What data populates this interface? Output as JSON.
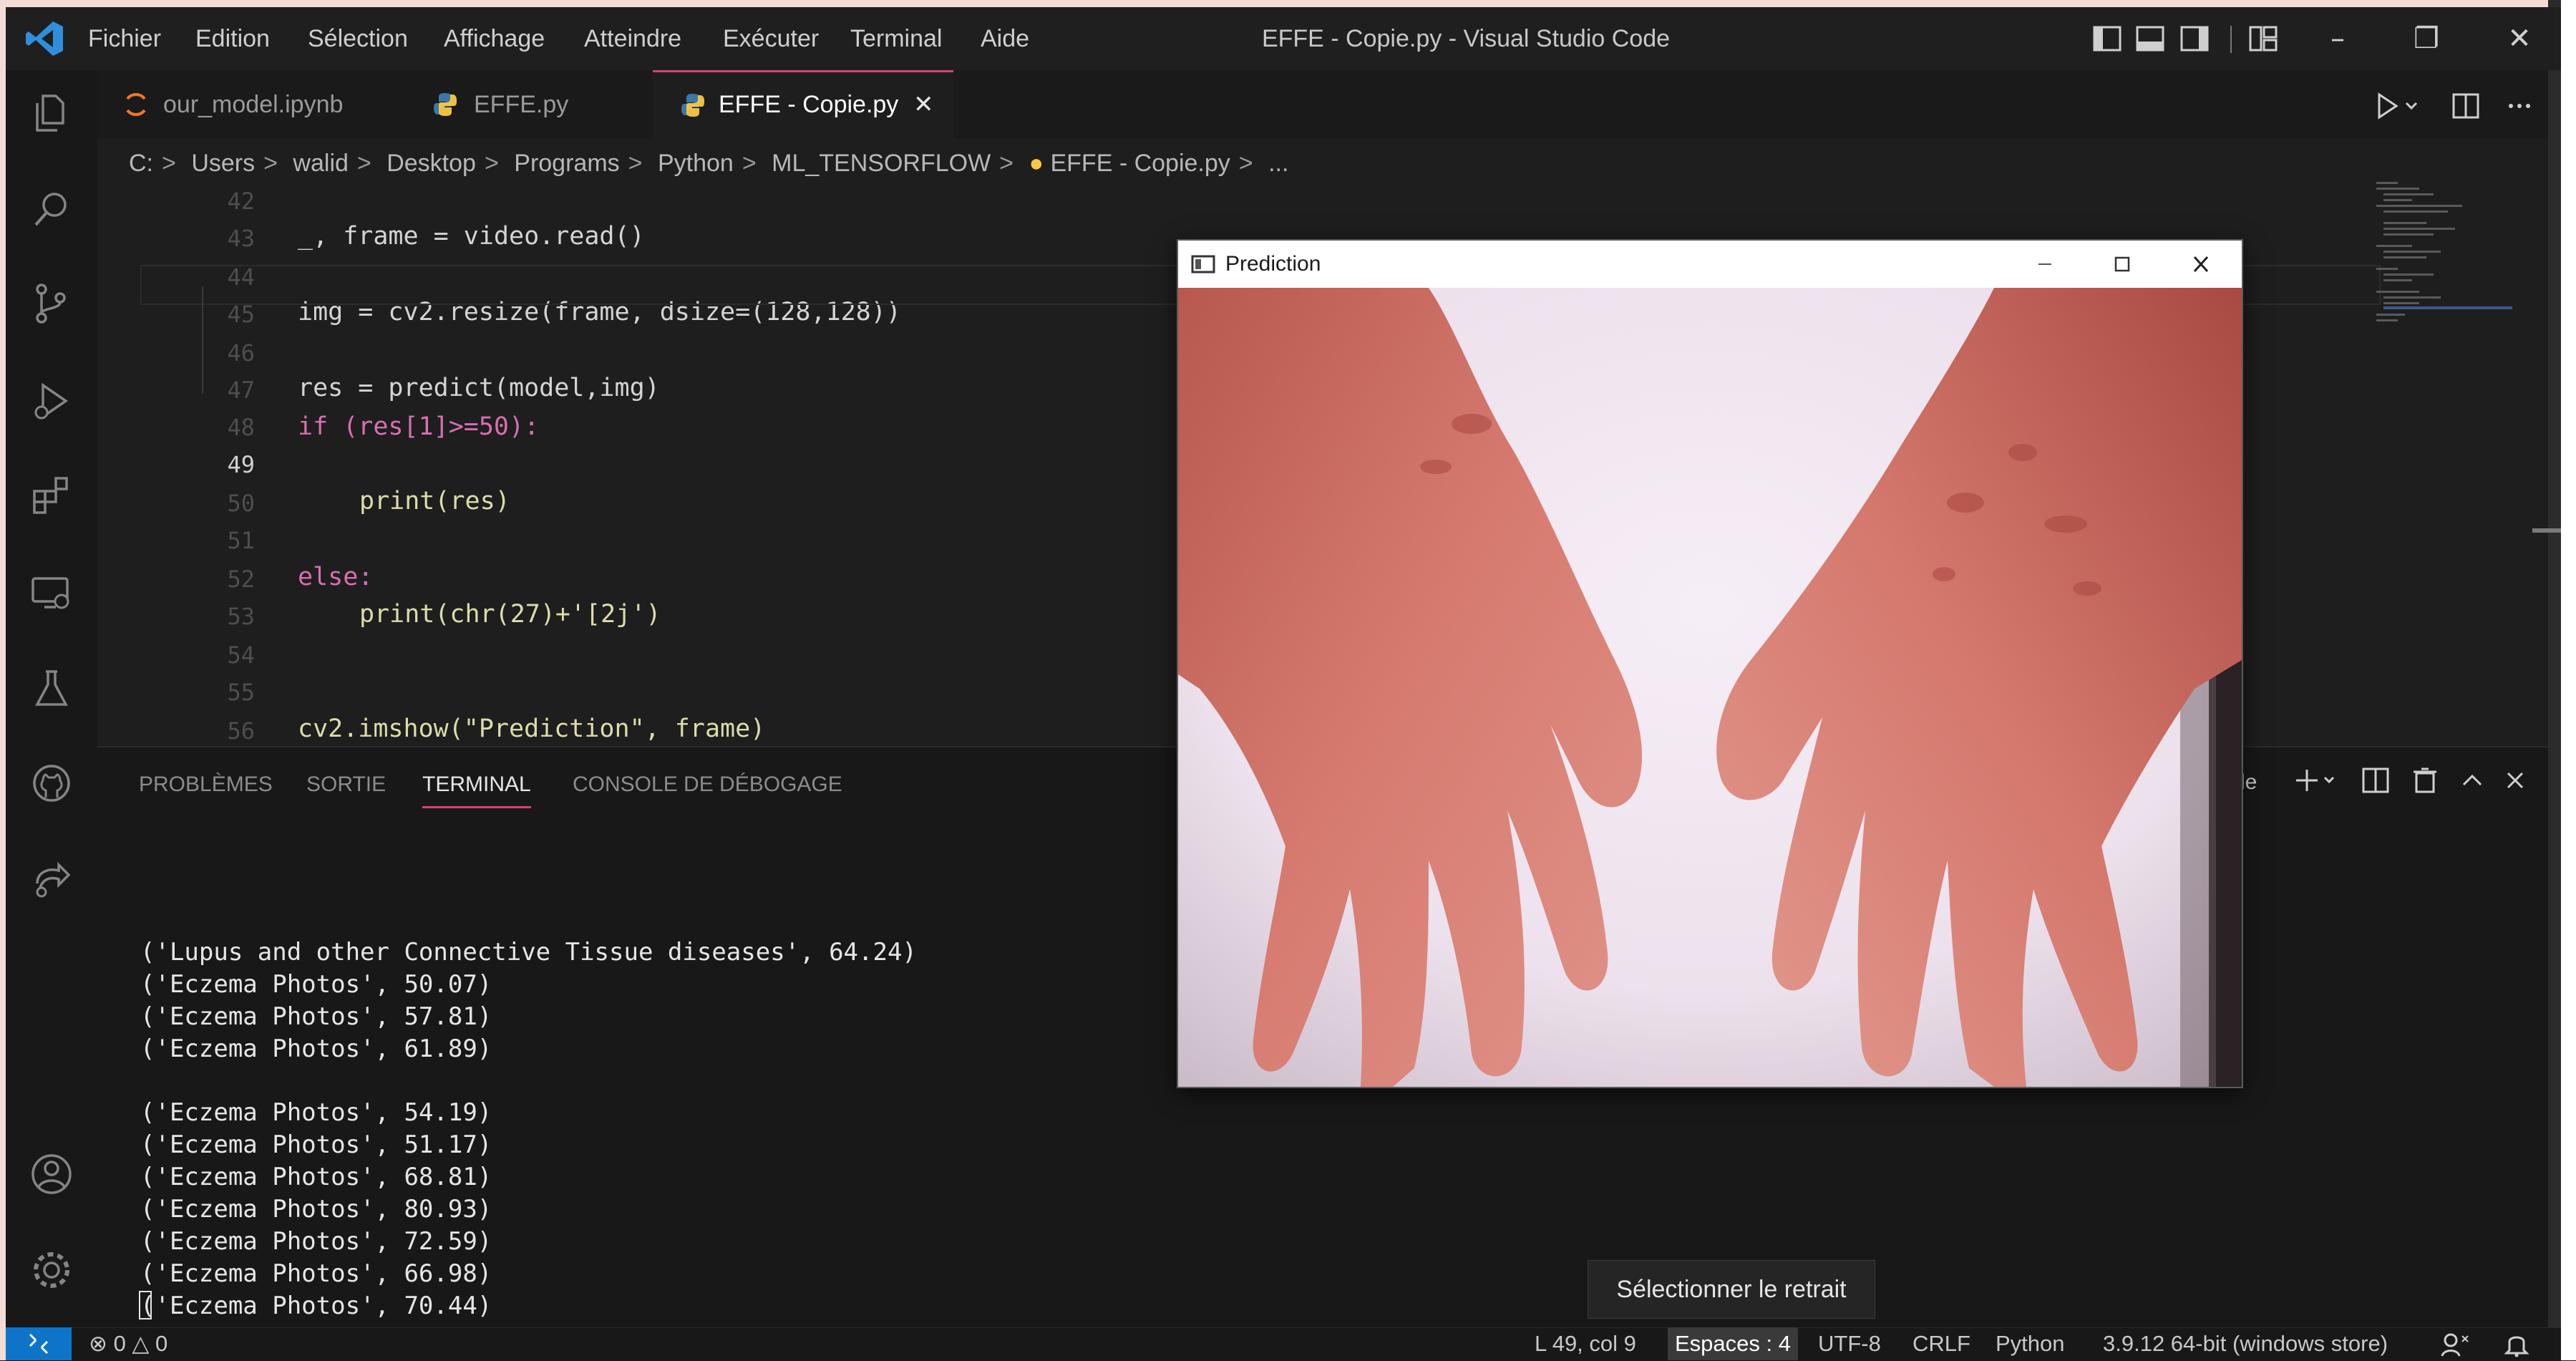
{
  "app": {
    "window_title": "EFFE - Copie.py - Visual Studio Code",
    "menu": [
      "Fichier",
      "Edition",
      "Sélection",
      "Affichage",
      "Atteindre",
      "Exécuter",
      "Terminal",
      "Aide"
    ]
  },
  "tabs": [
    {
      "label": "our_model.ipynb",
      "icon": "jupyter-notebook-icon",
      "active": false
    },
    {
      "label": "EFFE.py",
      "icon": "python-file-icon",
      "active": false
    },
    {
      "label": "EFFE - Copie.py",
      "icon": "python-file-icon",
      "active": true
    }
  ],
  "breadcrumb": [
    "C:",
    "Users",
    "walid",
    "Desktop",
    "Programs",
    "Python",
    "ML_TENSORFLOW",
    "EFFE - Copie.py",
    "..."
  ],
  "editor": {
    "line_numbers": [
      "42",
      "43",
      "44",
      "45",
      "46",
      "47",
      "48",
      "49",
      "50",
      "51",
      "52",
      "53",
      "54",
      "55",
      "56"
    ],
    "current_line": "49",
    "code": {
      "l43": "_, frame = video.read()",
      "l45": "img = cv2.resize(frame, dsize=(128,128))",
      "l47": "res = predict(model,img)",
      "l48": "if (res[1]>=50):",
      "l50": "print(res)",
      "l52": "else:",
      "l53": "print(chr(27)+'[2j')",
      "l56": "cv2.imshow(\"Prediction\", frame)"
    }
  },
  "panel": {
    "tabs": [
      "PROBLÈMES",
      "SORTIE",
      "TERMINAL",
      "CONSOLE DE DÉBOGAGE"
    ],
    "active_tab": "TERMINAL",
    "terminal_lines": [
      "('Lupus and other Connective Tissue diseases', 64.24)",
      "('Eczema Photos', 50.07)",
      "('Eczema Photos', 57.81)",
      "('Eczema Photos', 61.89)",
      "('Eczema Photos', 54.19)",
      "('Eczema Photos', 51.17)",
      "('Eczema Photos', 68.81)",
      "('Eczema Photos', 80.93)",
      "('Eczema Photos', 72.59)",
      "('Eczema Photos', 66.98)",
      "('Eczema Photos', 70.44)"
    ],
    "partial_label": "de",
    "tooltip": "Sélectionner le retrait"
  },
  "prediction_window": {
    "title": "Prediction"
  },
  "status": {
    "errors": "0",
    "warnings": "0",
    "position": "L 49, col 9",
    "indent": "Espaces : 4",
    "encoding": "UTF-8",
    "eol": "CRLF",
    "language": "Python",
    "interpreter": "3.9.12 64-bit (windows store)"
  },
  "colors": {
    "accent_tab": "#e03e6e",
    "remote_button": "#0e74c8",
    "vscode_logo": "#2f8fdd",
    "python_blue": "#3b77a8",
    "python_yellow": "#f7c948"
  }
}
